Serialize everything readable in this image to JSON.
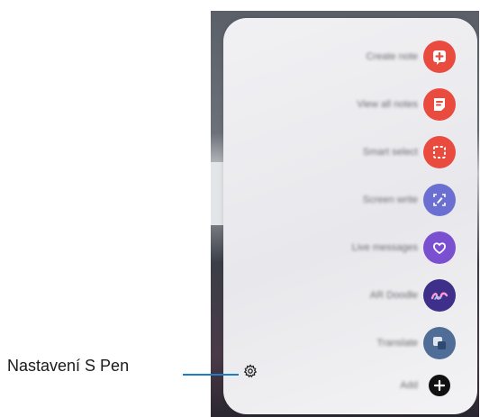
{
  "air_command": {
    "items": [
      {
        "label": "Create note",
        "icon": "note-add-icon",
        "color": "#ea4b3f"
      },
      {
        "label": "View all notes",
        "icon": "notes-list-icon",
        "color": "#ea4b3f"
      },
      {
        "label": "Smart select",
        "icon": "smart-select-icon",
        "color": "#ea4b3f"
      },
      {
        "label": "Screen write",
        "icon": "screen-write-icon",
        "color": "#6a6fd1"
      },
      {
        "label": "Live messages",
        "icon": "live-messages-icon",
        "color": "#7a4fd0"
      },
      {
        "label": "AR Doodle",
        "icon": "ar-doodle-icon",
        "color": "#3d2f8a"
      },
      {
        "label": "Translate",
        "icon": "translate-icon",
        "color": "#4f6d97"
      },
      {
        "label": "Add",
        "icon": "add-icon",
        "color": "#111111"
      }
    ],
    "settings_icon": "gear-icon"
  },
  "callout": {
    "label": "Nastavení S Pen",
    "line_color": "#1a7fc4"
  }
}
